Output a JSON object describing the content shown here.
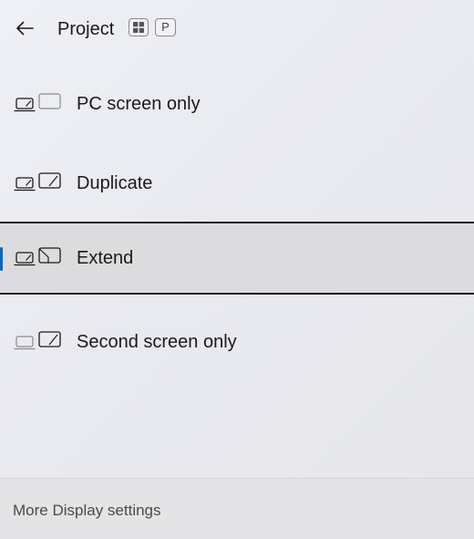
{
  "header": {
    "title": "Project",
    "shortcut_keys": [
      "P"
    ],
    "back_icon": "arrow-left-icon",
    "windows_key_icon": "windows-logo-icon"
  },
  "options": [
    {
      "label": "PC screen only",
      "icon": "pc-screen-only-icon",
      "selected": false
    },
    {
      "label": "Duplicate",
      "icon": "duplicate-icon",
      "selected": false
    },
    {
      "label": "Extend",
      "icon": "extend-icon",
      "selected": true
    },
    {
      "label": "Second screen only",
      "icon": "second-screen-only-icon",
      "selected": false
    }
  ],
  "footer": {
    "link_label": "More Display settings"
  },
  "colors": {
    "accent": "#0067c0",
    "selected_background": "#dcdcde",
    "selected_border": "#1c1c1c",
    "text": "#1a1a1a"
  }
}
